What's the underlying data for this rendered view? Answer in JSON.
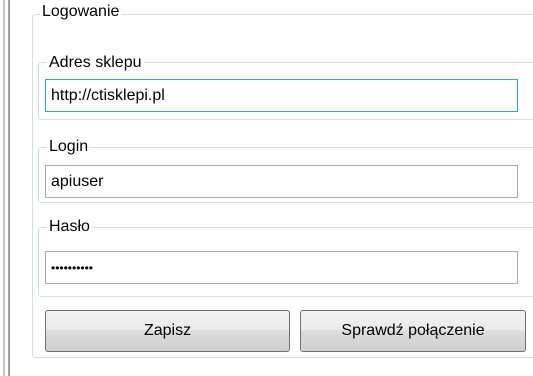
{
  "login_group": {
    "title": "Logowanie",
    "shop_address": {
      "label": "Adres sklepu",
      "value": "http://ctisklepi.pl"
    },
    "login": {
      "label": "Login",
      "value": "apiuser"
    },
    "password": {
      "label": "Hasło",
      "value": "••••••••••"
    }
  },
  "buttons": {
    "save_label": "Zapisz",
    "test_connection_label": "Sprawdź połączenie"
  },
  "colors": {
    "focus_border": "#3399ff",
    "groupbox_border": "#d5dfe5",
    "button_border": "#707070"
  }
}
